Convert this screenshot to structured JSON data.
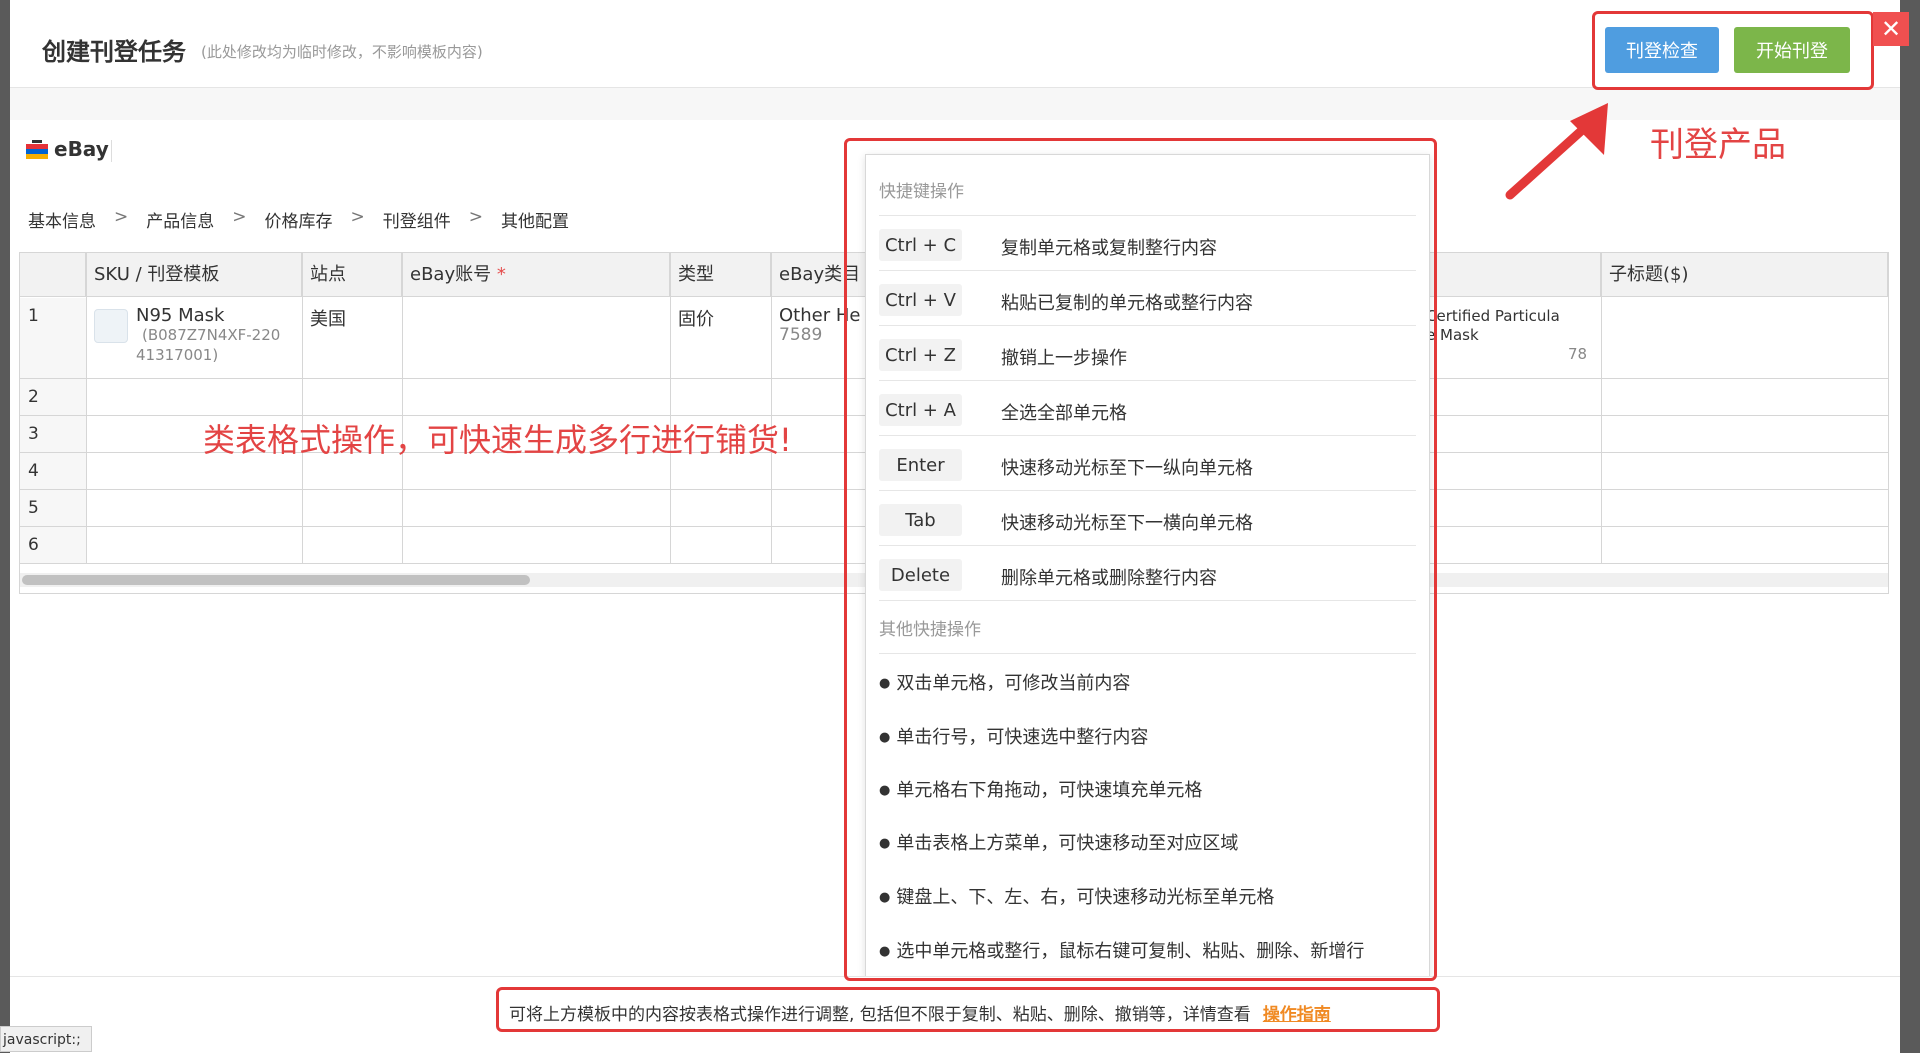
{
  "header": {
    "title": "创建刊登任务",
    "subtitle": "(此处修改均为临时修改，不影响模板内容)",
    "check_button": "刊登检查",
    "start_button": "开始刊登",
    "close": "✕"
  },
  "platform": {
    "name": "eBay"
  },
  "breadcrumb": [
    "基本信息",
    "产品信息",
    "价格库存",
    "刊登组件",
    "其他配置"
  ],
  "breadcrumb_sep": ">",
  "table": {
    "columns": [
      "SKU / 刊登模板",
      "站点",
      "eBay账号",
      "类型",
      "eBay类目",
      "子标题($)"
    ],
    "required_mark": "*",
    "row_numbers": [
      "1",
      "2",
      "3",
      "4",
      "5",
      "6"
    ],
    "row1": {
      "sku_name": "N95 Mask",
      "sku_code_line1": "(B087Z7N4XF-220",
      "sku_code_line2": "41317001)",
      "site": "美国",
      "type": "固价",
      "category_line1": "Other He",
      "category_line2": "7589",
      "title_line1": "Certified Particula",
      "title_line2": "e Mask",
      "title_count": "78"
    }
  },
  "annotations": {
    "table_ops": "类表格式操作，可快速生成多行进行铺货!",
    "publish": "刊登产品"
  },
  "shortcuts": {
    "section1": "快捷键操作",
    "keys": [
      {
        "key": "Ctrl + C",
        "desc": "复制单元格或复制整行内容"
      },
      {
        "key": "Ctrl + V",
        "desc": "粘贴已复制的单元格或整行内容"
      },
      {
        "key": "Ctrl + Z",
        "desc": "撤销上一步操作"
      },
      {
        "key": "Ctrl + A",
        "desc": "全选全部单元格"
      },
      {
        "key": "Enter",
        "desc": "快速移动光标至下一纵向单元格"
      },
      {
        "key": "Tab",
        "desc": "快速移动光标至下一横向单元格"
      },
      {
        "key": "Delete",
        "desc": "删除单元格或删除整行内容"
      }
    ],
    "section2": "其他快捷操作",
    "tips": [
      "双击单元格，可修改当前内容",
      "单击行号，可快速选中整行内容",
      "单元格右下角拖动，可快速填充单元格",
      "单击表格上方菜单，可快速移动至对应区域",
      "键盘上、下、左、右，可快速移动光标至单元格",
      "选中单元格或整行，鼠标右键可复制、粘贴、删除、新增行"
    ]
  },
  "footer": {
    "text": "可将上方模板中的内容按表格式操作进行调整, 包括但不限于复制、粘贴、删除、撤销等，详情查看",
    "link": "操作指南"
  },
  "statusbar": "javascript:;"
}
